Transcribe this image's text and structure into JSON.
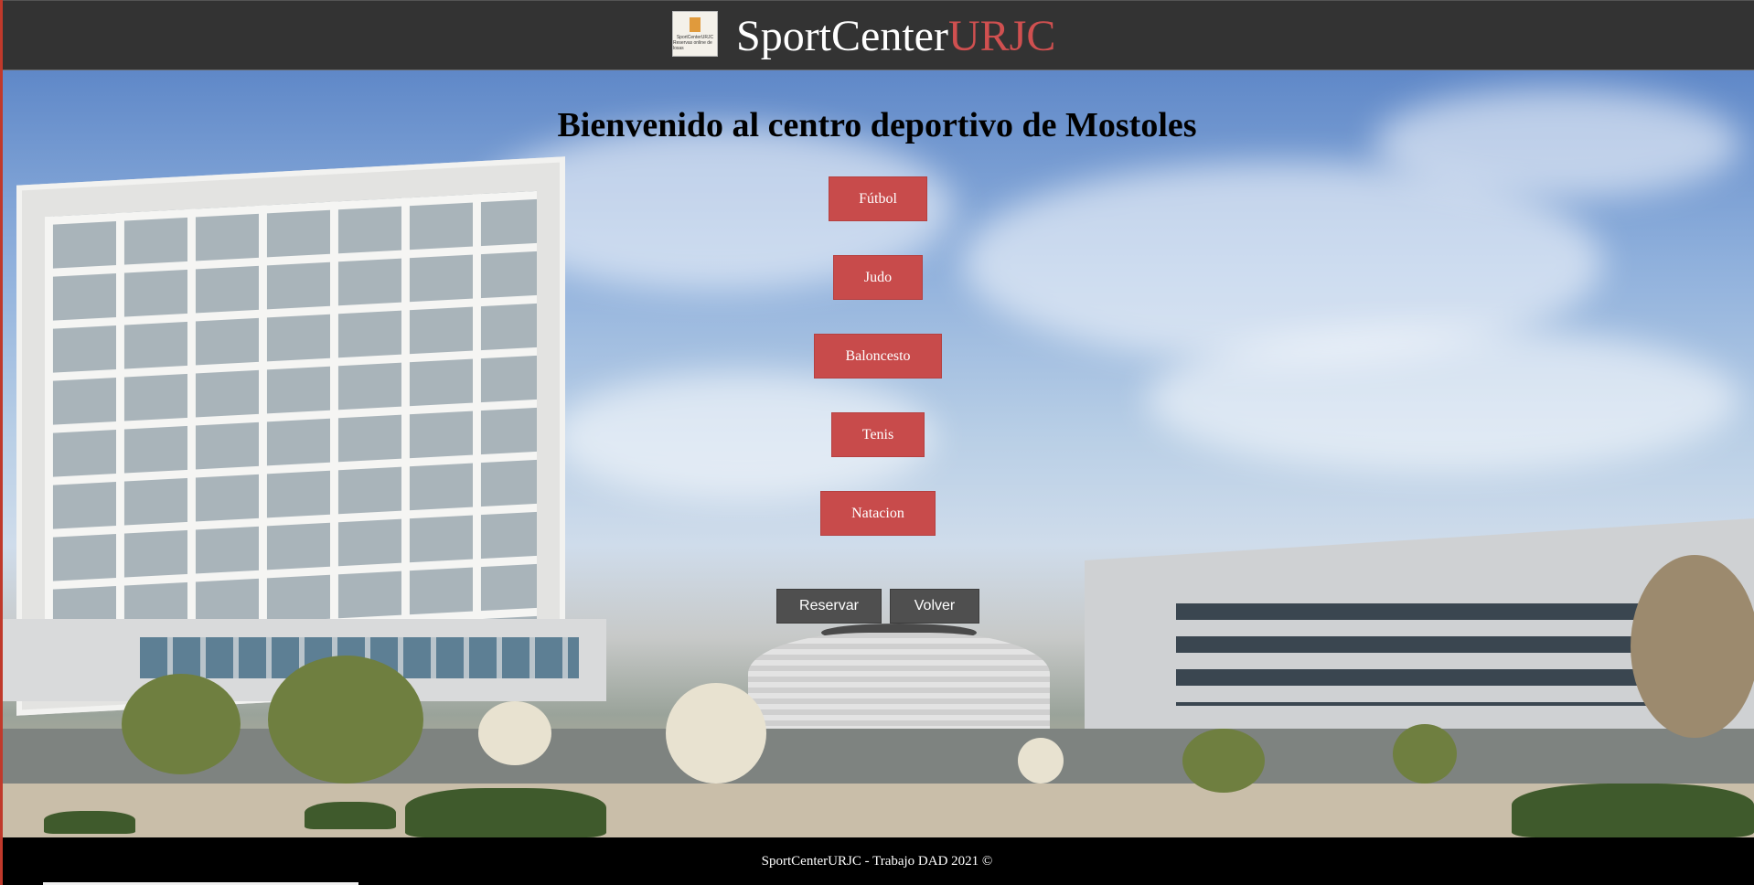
{
  "header": {
    "logo_text": "SportCenterURJC",
    "logo_subtext": "Reservas online de losas",
    "brand_main": "SportCenter",
    "brand_accent": "URJC"
  },
  "main": {
    "title": "Bienvenido al centro deportivo de Mostoles",
    "sports": [
      "Fútbol",
      "Judo",
      "Baloncesto",
      "Tenis",
      "Natacion"
    ],
    "actions": {
      "reserve_label": "Reservar",
      "back_label": "Volver"
    }
  },
  "footer": {
    "text": "SportCenterURJC - Trabajo DAD 2021 ©"
  },
  "colors": {
    "header_bg": "#333333",
    "accent": "#d05050",
    "sport_button": "#c84b4b",
    "action_button": "#4f4f4f",
    "footer_bg": "#000000"
  }
}
